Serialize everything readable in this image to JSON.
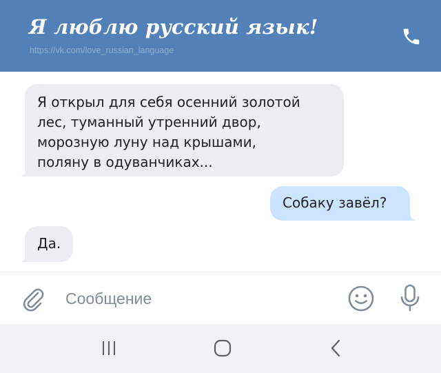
{
  "header": {
    "title": "Я люблю русский язык!",
    "url": "https://vk.com/love_russian_language",
    "call_icon": "phone-icon"
  },
  "messages": [
    {
      "direction": "incoming",
      "lines": [
        "Я открыл для себя осенний золотой",
        "лес, туманный утренний двор,",
        "морозную луну над крышами,",
        "поляну в одуванчиках..."
      ]
    },
    {
      "direction": "outgoing",
      "lines": [
        "Собаку завёл?"
      ]
    },
    {
      "direction": "incoming",
      "lines": [
        "Да."
      ]
    }
  ],
  "composer": {
    "placeholder": "Сообщение",
    "attach_icon": "paperclip-icon",
    "emoji_icon": "smile-icon",
    "mic_icon": "microphone-icon"
  },
  "navbar": {
    "recents_icon": "recents-icon",
    "home_icon": "home-icon",
    "back_icon": "back-icon"
  },
  "colors": {
    "header_bg": "#5181b8",
    "incoming_bubble": "#ebedf0",
    "outgoing_bubble": "#cce4ff",
    "icon_gray": "#818c99"
  }
}
